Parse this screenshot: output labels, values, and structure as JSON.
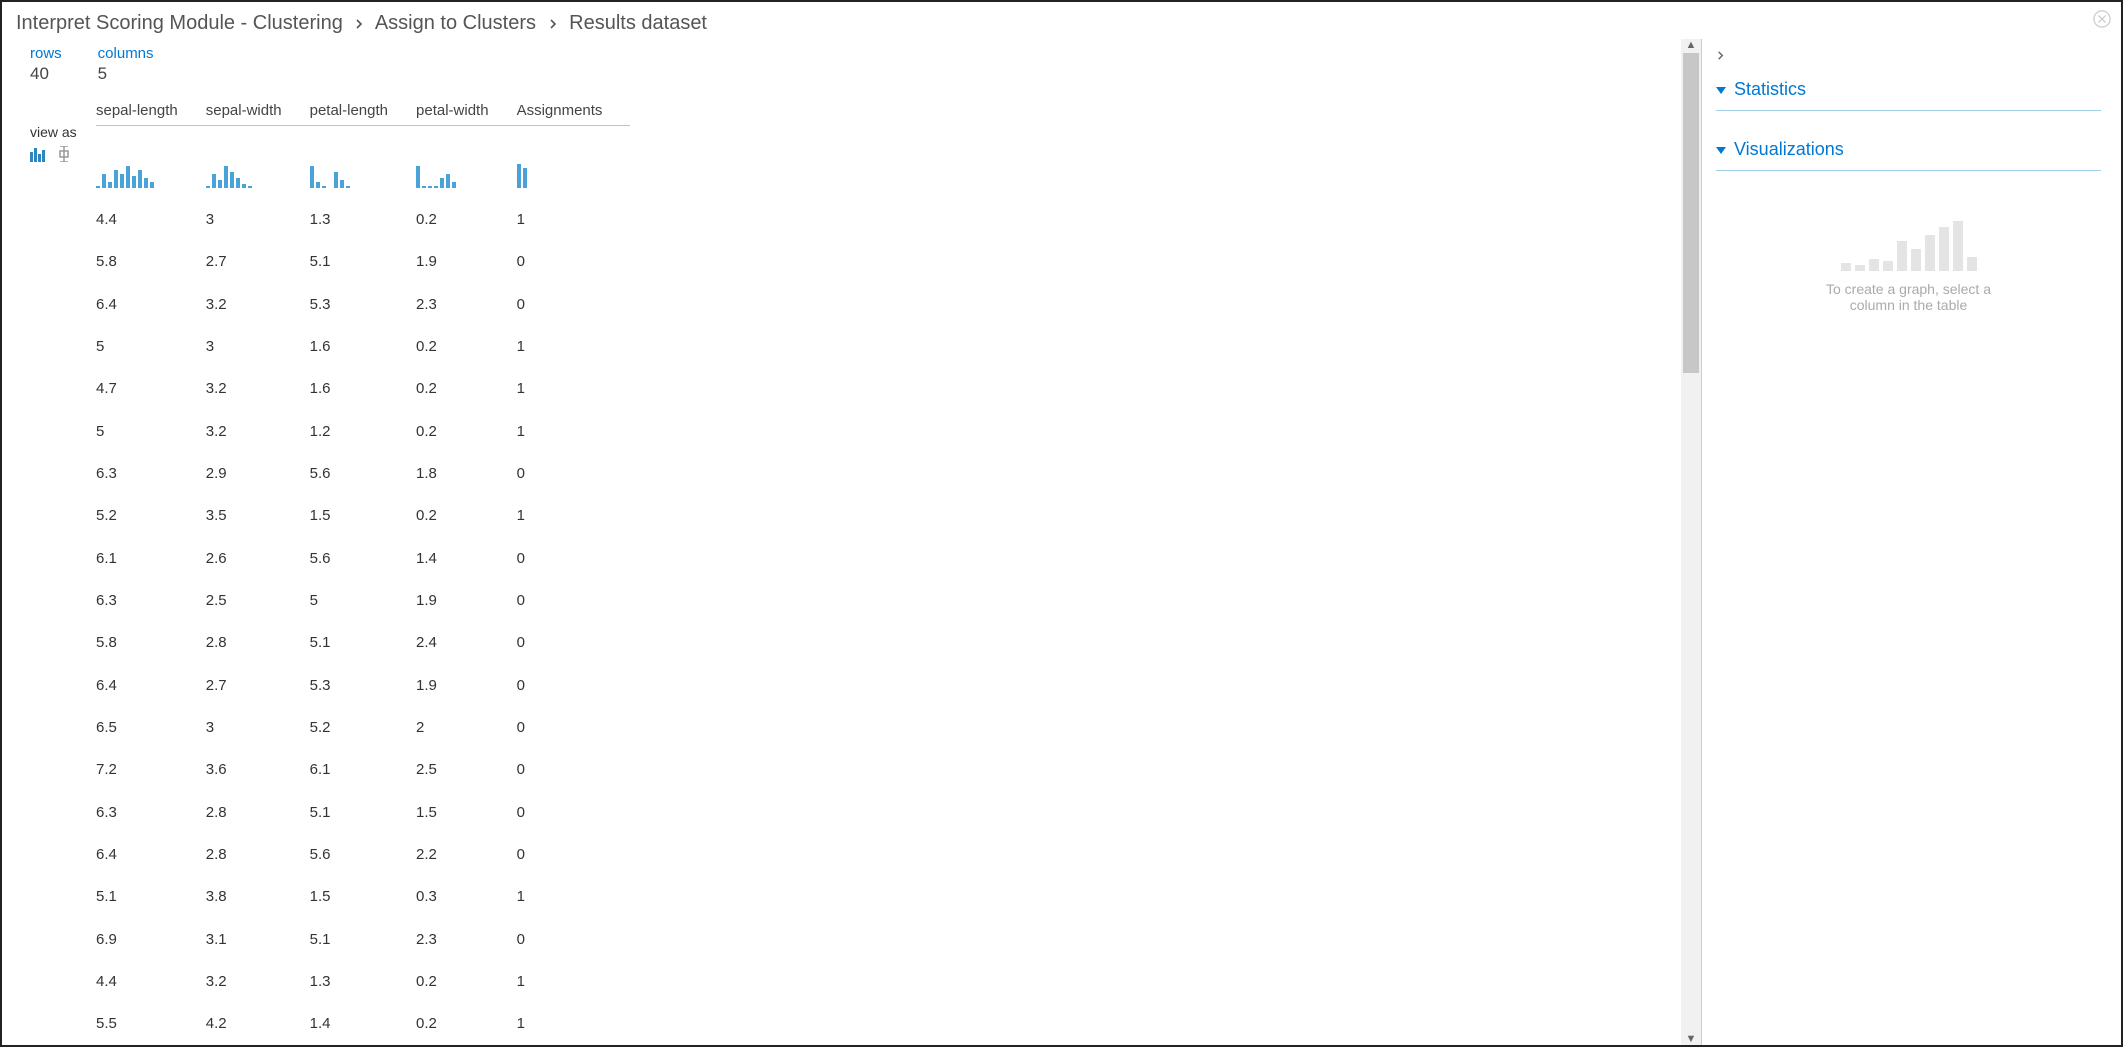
{
  "breadcrumb": {
    "items": [
      "Interpret Scoring Module - Clustering",
      "Assign to Clusters",
      "Results dataset"
    ]
  },
  "meta": {
    "rows_label": "rows",
    "rows_value": "40",
    "cols_label": "columns",
    "cols_value": "5"
  },
  "viewas_label": "view as",
  "columns": [
    "sepal-length",
    "sepal-width",
    "petal-length",
    "petal-width",
    "Assignments"
  ],
  "histograms": [
    [
      2,
      14,
      6,
      18,
      14,
      22,
      12,
      18,
      10,
      6
    ],
    [
      2,
      14,
      8,
      22,
      16,
      10,
      4,
      2
    ],
    [
      22,
      6,
      2,
      0,
      16,
      8,
      2
    ],
    [
      22,
      2,
      2,
      2,
      10,
      14,
      6
    ],
    [
      24,
      20
    ]
  ],
  "rows": [
    [
      "4.4",
      "3",
      "1.3",
      "0.2",
      "1"
    ],
    [
      "5.8",
      "2.7",
      "5.1",
      "1.9",
      "0"
    ],
    [
      "6.4",
      "3.2",
      "5.3",
      "2.3",
      "0"
    ],
    [
      "5",
      "3",
      "1.6",
      "0.2",
      "1"
    ],
    [
      "4.7",
      "3.2",
      "1.6",
      "0.2",
      "1"
    ],
    [
      "5",
      "3.2",
      "1.2",
      "0.2",
      "1"
    ],
    [
      "6.3",
      "2.9",
      "5.6",
      "1.8",
      "0"
    ],
    [
      "5.2",
      "3.5",
      "1.5",
      "0.2",
      "1"
    ],
    [
      "6.1",
      "2.6",
      "5.6",
      "1.4",
      "0"
    ],
    [
      "6.3",
      "2.5",
      "5",
      "1.9",
      "0"
    ],
    [
      "5.8",
      "2.8",
      "5.1",
      "2.4",
      "0"
    ],
    [
      "6.4",
      "2.7",
      "5.3",
      "1.9",
      "0"
    ],
    [
      "6.5",
      "3",
      "5.2",
      "2",
      "0"
    ],
    [
      "7.2",
      "3.6",
      "6.1",
      "2.5",
      "0"
    ],
    [
      "6.3",
      "2.8",
      "5.1",
      "1.5",
      "0"
    ],
    [
      "6.4",
      "2.8",
      "5.6",
      "2.2",
      "0"
    ],
    [
      "5.1",
      "3.8",
      "1.5",
      "0.3",
      "1"
    ],
    [
      "6.9",
      "3.1",
      "5.1",
      "2.3",
      "0"
    ],
    [
      "4.4",
      "3.2",
      "1.3",
      "0.2",
      "1"
    ],
    [
      "5.5",
      "4.2",
      "1.4",
      "0.2",
      "1"
    ]
  ],
  "right": {
    "statistics_label": "Statistics",
    "visualizations_label": "Visualizations",
    "placeholder_line1": "To create a graph, select a",
    "placeholder_line2": "column in the table"
  },
  "ghost_bars": [
    8,
    6,
    12,
    10,
    30,
    22,
    36,
    44,
    50,
    14
  ],
  "chart_data": {
    "type": "table",
    "title": "Results dataset",
    "columns": [
      "sepal-length",
      "sepal-width",
      "petal-length",
      "petal-width",
      "Assignments"
    ],
    "rows": [
      [
        4.4,
        3,
        1.3,
        0.2,
        1
      ],
      [
        5.8,
        2.7,
        5.1,
        1.9,
        0
      ],
      [
        6.4,
        3.2,
        5.3,
        2.3,
        0
      ],
      [
        5,
        3,
        1.6,
        0.2,
        1
      ],
      [
        4.7,
        3.2,
        1.6,
        0.2,
        1
      ],
      [
        5,
        3.2,
        1.2,
        0.2,
        1
      ],
      [
        6.3,
        2.9,
        5.6,
        1.8,
        0
      ],
      [
        5.2,
        3.5,
        1.5,
        0.2,
        1
      ],
      [
        6.1,
        2.6,
        5.6,
        1.4,
        0
      ],
      [
        6.3,
        2.5,
        5,
        1.9,
        0
      ],
      [
        5.8,
        2.8,
        5.1,
        2.4,
        0
      ],
      [
        6.4,
        2.7,
        5.3,
        1.9,
        0
      ],
      [
        6.5,
        3,
        5.2,
        2,
        0
      ],
      [
        7.2,
        3.6,
        6.1,
        2.5,
        0
      ],
      [
        6.3,
        2.8,
        5.1,
        1.5,
        0
      ],
      [
        6.4,
        2.8,
        5.6,
        2.2,
        0
      ],
      [
        5.1,
        3.8,
        1.5,
        0.3,
        1
      ],
      [
        6.9,
        3.1,
        5.1,
        2.3,
        0
      ],
      [
        4.4,
        3.2,
        1.3,
        0.2,
        1
      ],
      [
        5.5,
        4.2,
        1.4,
        0.2,
        1
      ]
    ]
  }
}
